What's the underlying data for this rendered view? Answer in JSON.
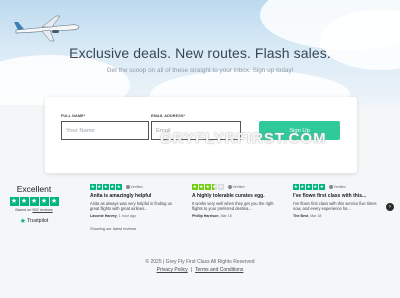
{
  "hero": {
    "headline": "Exclusive deals.  New routes.  Flash sales.",
    "subline": "Get the scoop on all of these straight to your inbox.  Sign up today!"
  },
  "form": {
    "full_name_label": "FULL NAME*",
    "full_name_placeholder": "Your Name",
    "email_label": "EMAIL ADDRESS*",
    "email_placeholder": "Email",
    "signup_label": "Sign Up"
  },
  "watermark": "GRYFLYRFIRST.COM",
  "trustpilot": {
    "rating_word": "Excellent",
    "based_on_prefix": "Based on",
    "review_count": "552 reviews",
    "logo": "Trustpilot",
    "showing": "Showing our latest reviews",
    "star_color": "#00b67a"
  },
  "reviews": [
    {
      "stars": 5,
      "verified": "Verified",
      "title": "Anita is amazingly helpful",
      "body": "Anita as always was very helpful in finding us great flights with great airlines...",
      "author": "Lavonte Harvey",
      "date": "1 hour ago"
    },
    {
      "stars": 3.5,
      "verified": "Verified",
      "title": "A highly tolerable curates egg.",
      "body": "It works very well when they get you the right flights to your preferred destina...",
      "author": "Phillip Harrison",
      "date": "Mar 18"
    },
    {
      "stars": 5,
      "verified": "Verified",
      "title": "I've flown first class with this...",
      "body": "I've flown first class with this service five times now, and every experience ha...",
      "author": "The Best",
      "date": "Mar 18"
    }
  ],
  "footer": {
    "copyright": "© 2025 | Grey Fly First Class All Rights Reserved",
    "privacy": "Privacy Policy",
    "terms": "Terms and Conditions"
  },
  "colors": {
    "accent": "#2fc99a",
    "trustpilot_green": "#00b67a",
    "heading": "#3a4753"
  }
}
